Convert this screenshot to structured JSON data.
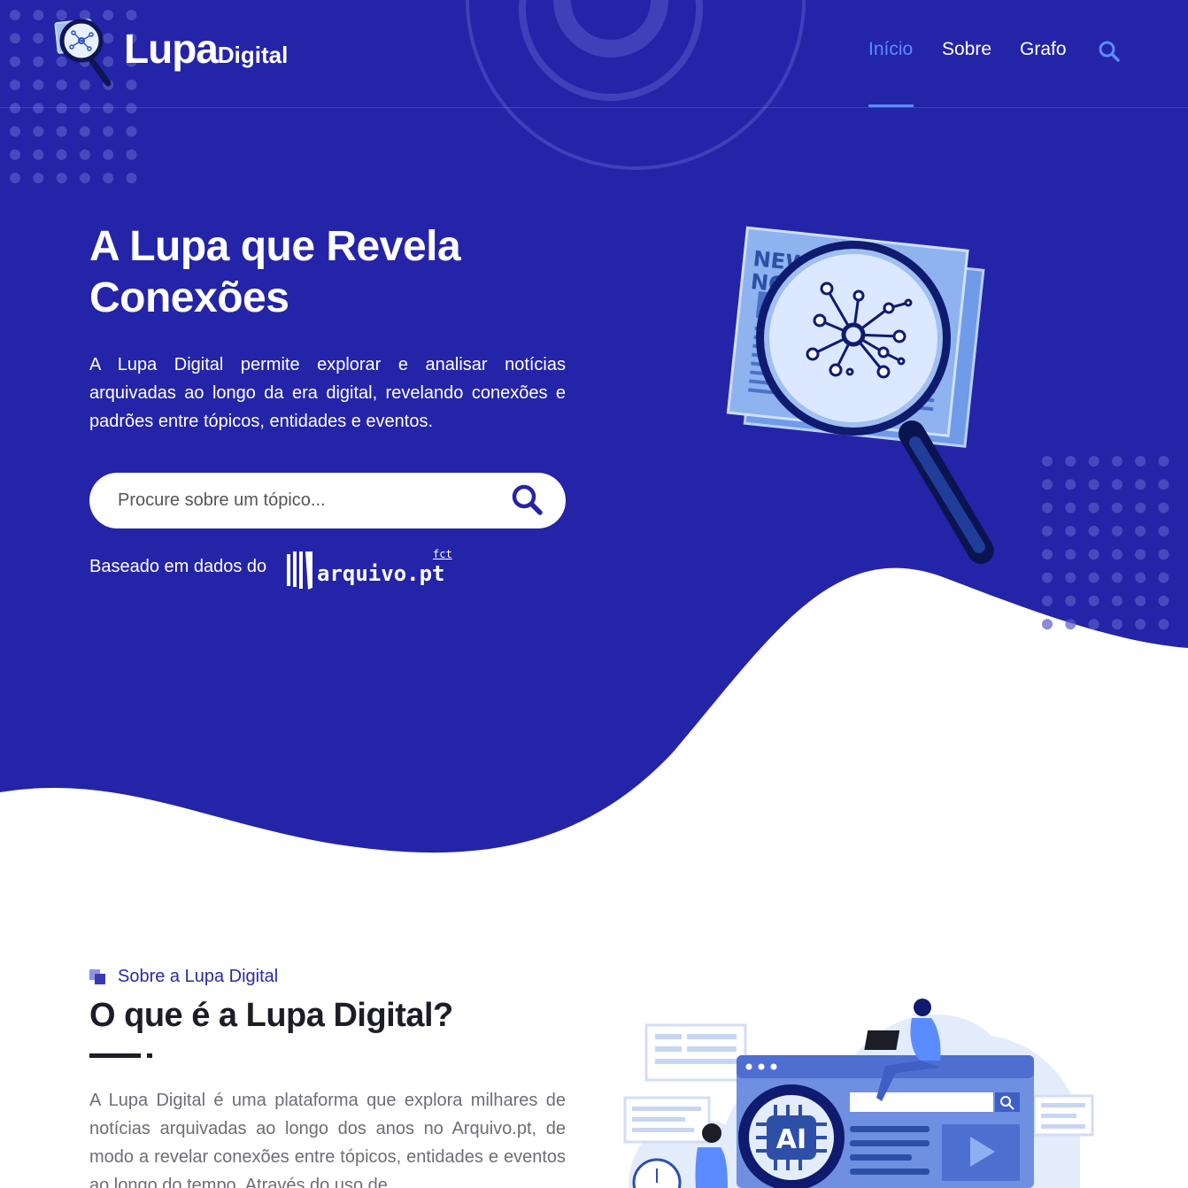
{
  "brand": {
    "name": "Lupa",
    "sub": "Digital"
  },
  "nav": {
    "items": [
      {
        "label": "Início",
        "active": true
      },
      {
        "label": "Sobre",
        "active": false
      },
      {
        "label": "Grafo",
        "active": false
      }
    ],
    "search_icon": "search-icon"
  },
  "hero": {
    "title_line1": "A Lupa que Revela",
    "title_line2": "Conexões",
    "description": "A Lupa Digital permite explorar e analisar notícias arquivadas ao longo da era digital, revelando conexões e padrões entre tópicos, entidades e eventos.",
    "search_placeholder": "Procure sobre um tópico...",
    "based_on": "Baseado em dados do",
    "source_logo": {
      "name": "arquivo.pt",
      "badge": "fct"
    },
    "illustration_text": [
      "NEW",
      "NO"
    ]
  },
  "about": {
    "tag": "Sobre a Lupa Digital",
    "title": "O que é a Lupa Digital?",
    "text": "A Lupa Digital é uma plataforma que explora milhares de notícias arquivadas ao longo dos anos no Arquivo.pt, de modo a revelar conexões entre tópicos, entidades e eventos ao longo do tempo. Através do uso de",
    "illustration_label": "AI"
  },
  "colors": {
    "hero_bg": "#2424a8",
    "accent": "#5b8cff",
    "text_dark": "#1d1d27",
    "text_muted": "#6d6d78",
    "tag": "#2a2a9f"
  }
}
